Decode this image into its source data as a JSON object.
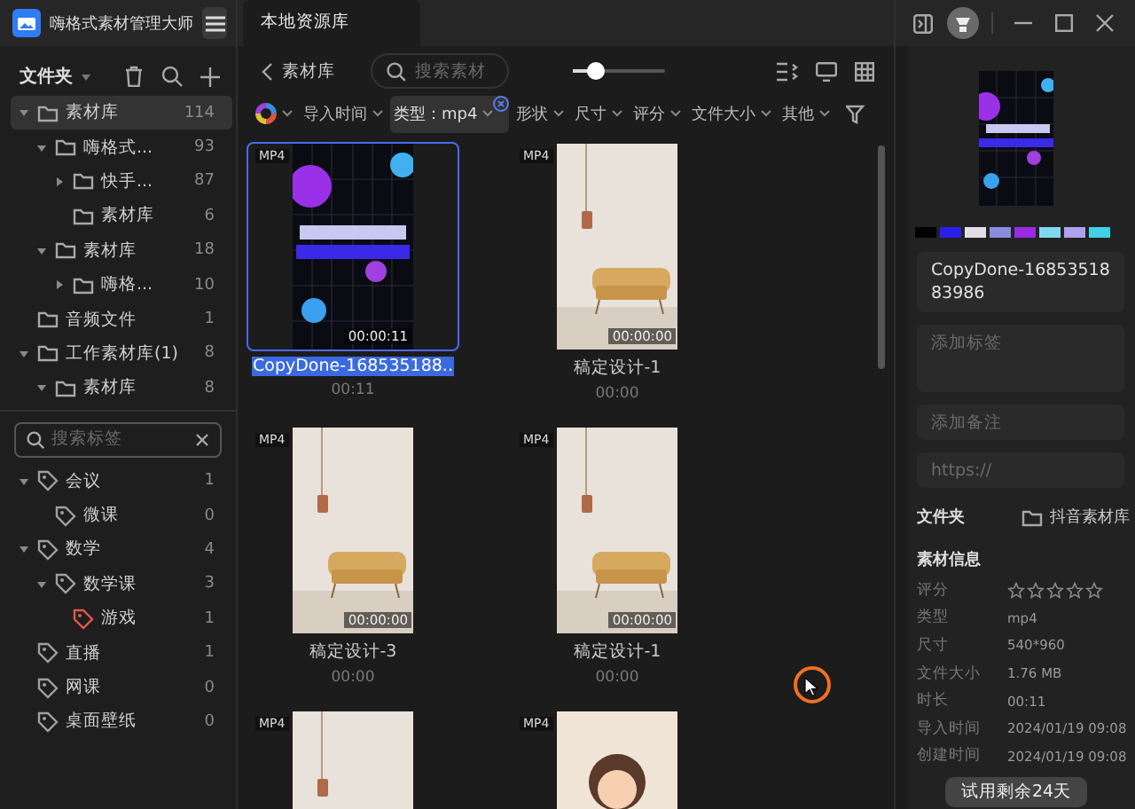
{
  "app": {
    "title": "嗨格式素材管理大师"
  },
  "folders": {
    "title": "文件夹",
    "items": [
      {
        "label": "素材库",
        "count": "114",
        "selected": true,
        "expanded": true,
        "children": [
          {
            "label": "嗨格式...",
            "count": "93",
            "selected": false,
            "expanded": true,
            "children": [
              {
                "label": "快手...",
                "count": "87",
                "selected": false,
                "expanded": false
              },
              {
                "label": "素材库",
                "count": "6",
                "selected": false
              }
            ]
          },
          {
            "label": "素材库",
            "count": "18",
            "selected": false,
            "expanded": true,
            "children": [
              {
                "label": "嗨格...",
                "count": "10",
                "selected": false,
                "expanded": false
              }
            ]
          }
        ]
      },
      {
        "label": "音频文件",
        "count": "1",
        "selected": false
      },
      {
        "label": "工作素材库(1)",
        "count": "8",
        "selected": false,
        "expanded": true,
        "children": [
          {
            "label": "素材库",
            "count": "8",
            "selected": false,
            "expanded": true
          }
        ]
      }
    ]
  },
  "tag_search": {
    "placeholder": "搜索标签"
  },
  "tags": [
    {
      "label": "会议",
      "count": "1",
      "color": "#a0a0a0",
      "expanded": true,
      "children": [
        {
          "label": "微课",
          "count": "0",
          "color": "#a0a0a0"
        }
      ]
    },
    {
      "label": "数学",
      "count": "4",
      "color": "#a0a0a0",
      "expanded": true,
      "children": [
        {
          "label": "数学课",
          "count": "3",
          "color": "#a0a0a0",
          "expanded": true,
          "children": [
            {
              "label": "游戏",
              "count": "1",
              "color": "#e05a4a"
            }
          ]
        }
      ]
    },
    {
      "label": "直播",
      "count": "1",
      "color": "#a0a0a0"
    },
    {
      "label": "网课",
      "count": "0",
      "color": "#a0a0a0"
    },
    {
      "label": "桌面壁纸",
      "count": "0",
      "color": "#a0a0a0"
    }
  ],
  "tabs": [
    {
      "label": "本地资源库",
      "selected": true
    }
  ],
  "toolbar": {
    "path": "素材库",
    "search": {
      "placeholder": "搜索素材"
    },
    "zoom": {
      "level": 0.25
    }
  },
  "filters": [
    {
      "kind": "color",
      "active": false
    },
    {
      "kind": "dropdown",
      "label": "导入时间",
      "active": false
    },
    {
      "kind": "dropdown",
      "label": "类型：mp4",
      "active": true
    },
    {
      "kind": "dropdown",
      "label": "形状",
      "active": false
    },
    {
      "kind": "dropdown",
      "label": "尺寸",
      "active": false
    },
    {
      "kind": "dropdown",
      "label": "评分",
      "active": false
    },
    {
      "kind": "dropdown",
      "label": "文件大小",
      "active": false
    },
    {
      "kind": "dropdown",
      "label": "其他",
      "active": false
    }
  ],
  "assets": [
    {
      "badge": "MP4",
      "kind": "neon",
      "time": "00:00:11",
      "name": "CopyDone-168535188..",
      "duration": "00:11",
      "selected": true
    },
    {
      "badge": "MP4",
      "kind": "room",
      "time": "00:00:00",
      "name": "稿定设计-1",
      "duration": "00:00",
      "selected": false
    },
    {
      "badge": "MP4",
      "kind": "room",
      "time": "00:00:00",
      "name": "稿定设计-3",
      "duration": "00:00",
      "selected": false
    },
    {
      "badge": "MP4",
      "kind": "room",
      "time": "00:00:00",
      "name": "稿定设计-1",
      "duration": "00:00",
      "selected": false
    },
    {
      "badge": "MP4",
      "kind": "room",
      "selected": false
    },
    {
      "badge": "MP4",
      "kind": "cartoon",
      "selected": false
    }
  ],
  "detail": {
    "palette": [
      {
        "color": "#000000"
      },
      {
        "color": "#2a1ee8"
      },
      {
        "color": "#e0e0e8"
      },
      {
        "color": "#8a8ae0"
      },
      {
        "color": "#9a2ae0"
      },
      {
        "color": "#80d8f0"
      },
      {
        "color": "#b0a0f0"
      },
      {
        "color": "#40d0e8"
      }
    ],
    "name": "CopyDone-1685351883986",
    "tags_placeholder": "添加标签",
    "note_placeholder": "添加备注",
    "url_placeholder": "https://",
    "folder_label": "文件夹",
    "folder_value": "抖音素材库",
    "info_title": "素材信息",
    "info": [
      {
        "kind": "stars",
        "label": "评分",
        "stars": 0
      },
      {
        "kind": "text",
        "label": "类型",
        "value": "mp4"
      },
      {
        "kind": "text",
        "label": "尺寸",
        "value": "540*960"
      },
      {
        "kind": "text",
        "label": "文件大小",
        "value": "1.76 MB"
      },
      {
        "kind": "text",
        "label": "时长",
        "value": "00:11"
      },
      {
        "kind": "text",
        "label": "导入时间",
        "value": "2024/01/19 09:08"
      },
      {
        "kind": "text",
        "label": "创建时间",
        "value": "2024/01/19 09:08"
      }
    ]
  },
  "toast": {
    "text": "试用剩余24天"
  }
}
